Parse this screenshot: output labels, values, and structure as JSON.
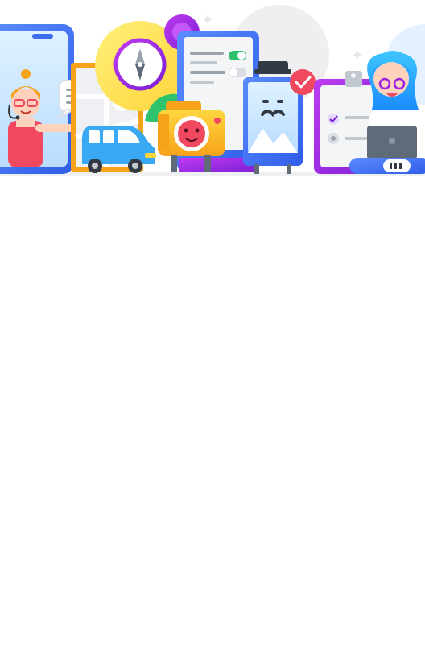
{
  "hero": {
    "illustration": "app-collage-illustration",
    "icons": [
      "phone-support-agent-icon",
      "speech-bubble-location-icon",
      "map-icon",
      "compass-icon",
      "van-icon",
      "settings-toggle-icon",
      "camera-icon",
      "photo-frame-icon",
      "checkmark-badge-icon",
      "clipboard-checklist-icon",
      "developer-laptop-icon",
      "battery-icon"
    ],
    "colors": {
      "blue": "#3d6ef2",
      "purple": "#9b23e0",
      "orange": "#f7a21b",
      "yellow": "#ffd43a",
      "red": "#f0485f",
      "green": "#2dc26b",
      "gray": "#e9ebee"
    },
    "toggle_states": [
      true,
      false
    ],
    "battery_level": 0.75
  },
  "content": {
    "blocks": []
  }
}
